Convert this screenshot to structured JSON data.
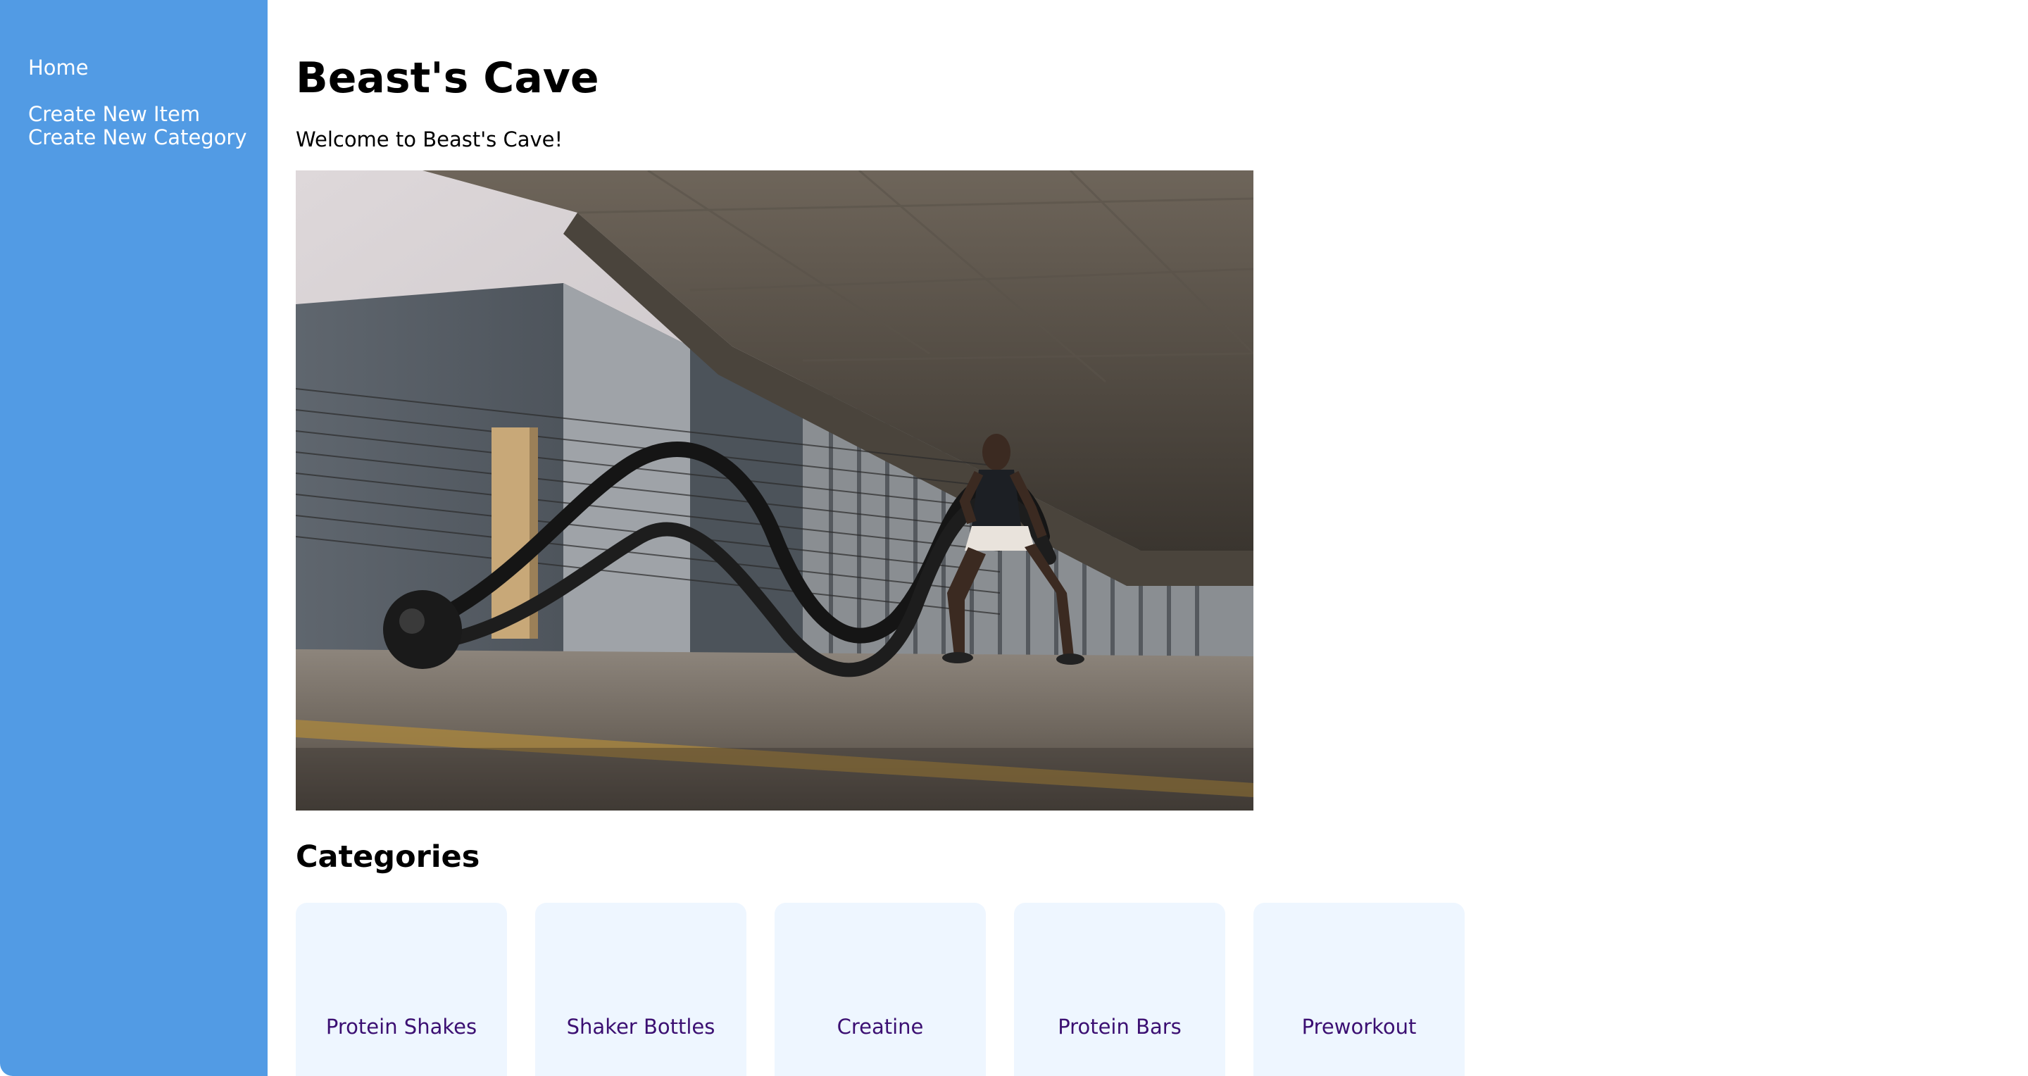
{
  "sidebar": {
    "links": [
      {
        "label": "Home"
      },
      {
        "label": "Create New Item"
      },
      {
        "label": "Create New Category"
      }
    ]
  },
  "main": {
    "title": "Beast's Cave",
    "welcome": "Welcome to Beast's Cave!",
    "hero_image": "photo-man-battle-ropes-parking-garage",
    "categories_heading": "Categories",
    "categories": [
      {
        "label": "Protein Shakes"
      },
      {
        "label": "Shaker Bottles"
      },
      {
        "label": "Creatine"
      },
      {
        "label": "Protein Bars"
      },
      {
        "label": "Preworkout"
      }
    ]
  },
  "colors": {
    "sidebar_bg": "#529be4",
    "card_bg": "#eef6ff",
    "card_text": "#3b0f72"
  }
}
